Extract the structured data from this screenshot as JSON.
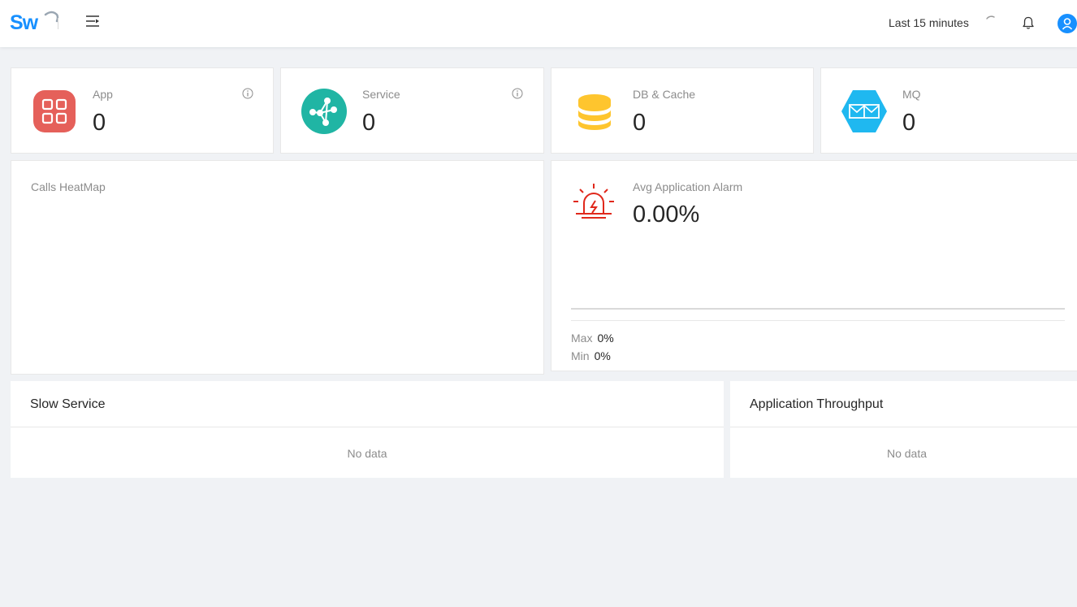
{
  "header": {
    "logo_text": "Sw",
    "time_range": "Last 15 minutes"
  },
  "stats": [
    {
      "label": "App",
      "value": "0",
      "icon": "app-grid-icon",
      "color": "#e5605a"
    },
    {
      "label": "Service",
      "value": "0",
      "icon": "service-network-icon",
      "color": "#20b5a4"
    },
    {
      "label": "DB & Cache",
      "value": "0",
      "icon": "database-icon",
      "color": "#fec52e"
    },
    {
      "label": "MQ",
      "value": "0",
      "icon": "message-queue-icon",
      "color": "#1fb8f0"
    }
  ],
  "heatmap": {
    "title": "Calls HeatMap"
  },
  "alarm": {
    "label": "Avg Application Alarm",
    "value": "0.00%",
    "max_label": "Max",
    "max_value": "0%",
    "min_label": "Min",
    "min_value": "0%",
    "color": "#e0281b"
  },
  "slow_service": {
    "title": "Slow Service",
    "empty_text": "No data"
  },
  "throughput": {
    "title": "Application Throughput",
    "empty_text": "No data"
  },
  "colors": {
    "brand": "#1890ff",
    "background": "#f0f2f5"
  }
}
